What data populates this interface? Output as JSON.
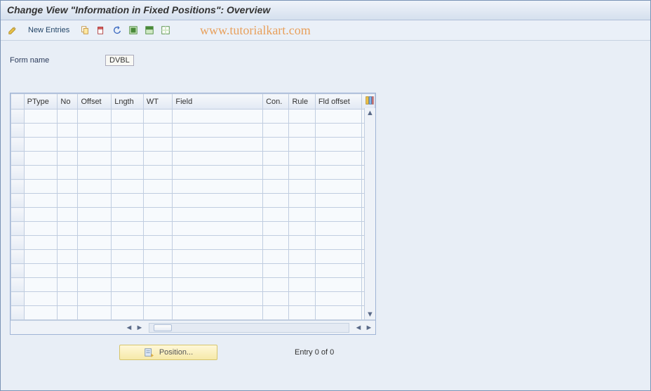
{
  "header": {
    "title": "Change View \"Information in Fixed Positions\": Overview"
  },
  "toolbar": {
    "new_entries_label": "New Entries"
  },
  "watermark": "www.tutorialkart.com",
  "form": {
    "name_label": "Form name",
    "name_value": "DVBL"
  },
  "table": {
    "columns": [
      "PType",
      "No",
      "Offset",
      "Lngth",
      "WT",
      "Field",
      "Con.",
      "Rule",
      "Fld offset"
    ],
    "visible_rows": 15
  },
  "footer": {
    "position_label": "Position...",
    "entry_text": "Entry 0 of 0"
  }
}
